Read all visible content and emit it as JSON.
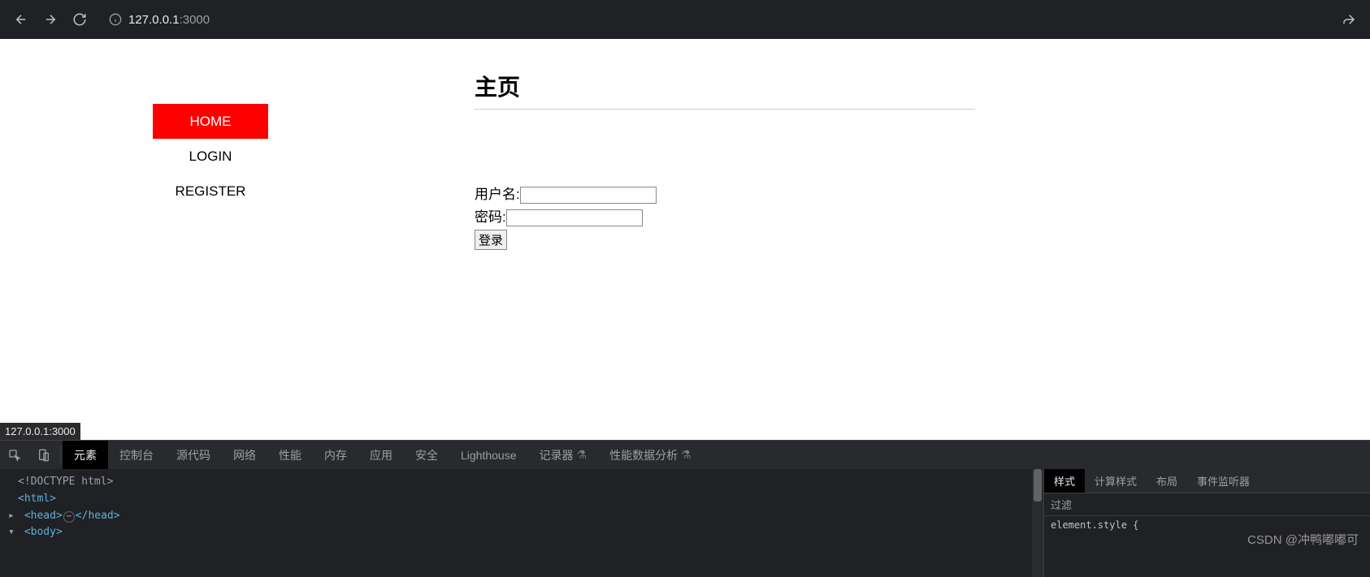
{
  "browser": {
    "url_host": "127.0.0.1",
    "url_port": ":3000"
  },
  "nav": {
    "items": [
      {
        "label": "HOME",
        "active": true
      },
      {
        "label": "LOGIN",
        "active": false
      },
      {
        "label": "REGISTER",
        "active": false
      }
    ]
  },
  "content": {
    "title": "主页",
    "form": {
      "username_label": "用户名:",
      "password_label": "密码:",
      "submit_label": "登录"
    }
  },
  "status_bar": "127.0.0.1:3000",
  "devtools": {
    "tabs": [
      "元素",
      "控制台",
      "源代码",
      "网络",
      "性能",
      "内存",
      "应用",
      "安全",
      "Lighthouse",
      "记录器",
      "性能数据分析"
    ],
    "active_tab": "元素",
    "elements_lines": {
      "doctype": "<!DOCTYPE html>",
      "html_open": "<html>",
      "head_open": "<head>",
      "head_close": "</head>",
      "body_open": "<body>"
    },
    "styles": {
      "tabs": [
        "样式",
        "计算样式",
        "布局",
        "事件监听器"
      ],
      "active_tab": "样式",
      "filter_placeholder": "过滤",
      "body_text": "element.style {"
    }
  },
  "watermark": "CSDN @冲鸭嘟嘟可"
}
